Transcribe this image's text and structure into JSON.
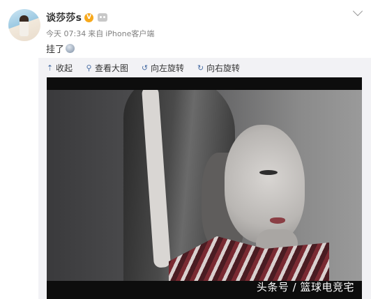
{
  "user": {
    "name": "谈莎莎s",
    "badge_glyph": "V"
  },
  "post": {
    "time": "今天 07:34",
    "source_prefix": "来自",
    "source": "iPhone客户端",
    "text": "挂了"
  },
  "toolbar": {
    "collapse": "收起",
    "view_large": "查看大图",
    "rotate_left": "向左旋转",
    "rotate_right": "向右旋转"
  },
  "watermark": "头条号 / 篮球电竞宅",
  "colors": {
    "panel_bg": "#f2f2f5",
    "icon_blue": "#4a6fa5",
    "vip_badge": "#f7a81b"
  }
}
